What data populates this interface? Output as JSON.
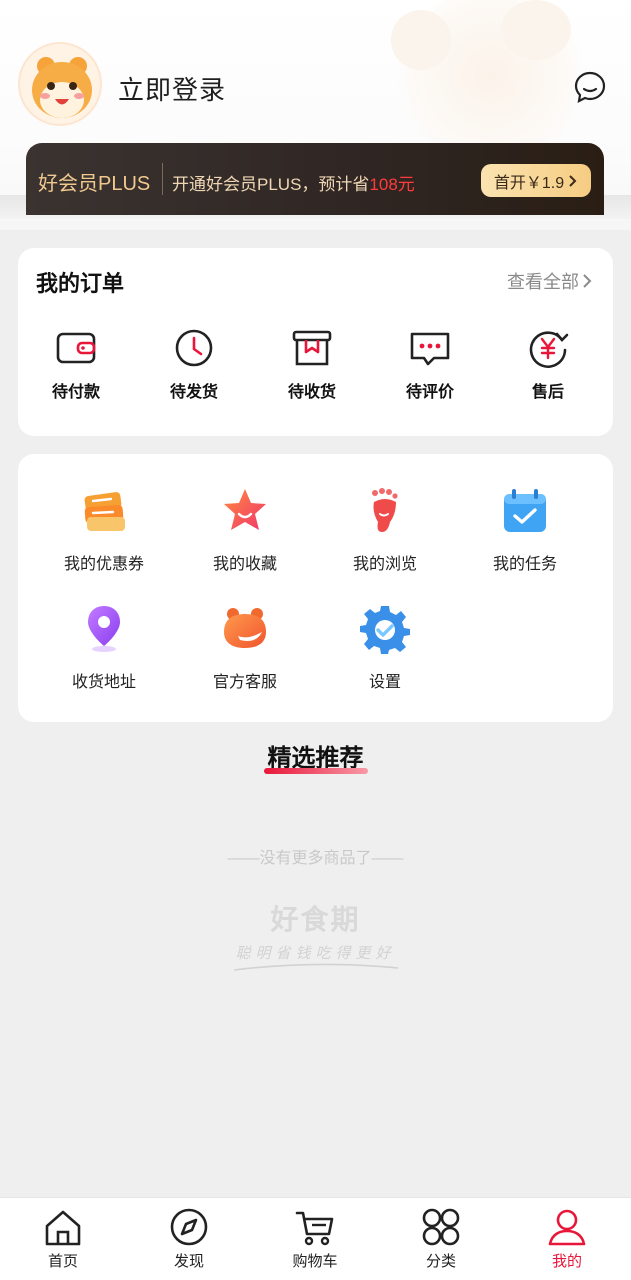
{
  "header": {
    "login_text": "立即登录",
    "message_icon": "chat-bubble-icon",
    "avatar_icon": "hamster-avatar-icon"
  },
  "plus": {
    "title": "好会员PLUS",
    "desc_prefix": "开通好会员PLUS，预计省",
    "save_amount": "108元",
    "button_label": "首开￥1.9",
    "accent_color": "#f1c98f",
    "highlight_color": "#ff3b3b"
  },
  "orders": {
    "title": "我的订单",
    "view_all": "查看全部",
    "items": [
      {
        "label": "待付款",
        "icon": "wallet-icon"
      },
      {
        "label": "待发货",
        "icon": "clock-icon"
      },
      {
        "label": "待收货",
        "icon": "box-icon"
      },
      {
        "label": "待评价",
        "icon": "comment-icon"
      },
      {
        "label": "售后",
        "icon": "yen-refresh-icon"
      }
    ]
  },
  "tools": {
    "items": [
      {
        "label": "我的优惠券",
        "icon": "coupon-icon"
      },
      {
        "label": "我的收藏",
        "icon": "star-icon"
      },
      {
        "label": "我的浏览",
        "icon": "footprint-icon"
      },
      {
        "label": "我的任务",
        "icon": "calendar-check-icon"
      },
      {
        "label": "收货地址",
        "icon": "location-pin-icon"
      },
      {
        "label": "官方客服",
        "icon": "customer-service-icon"
      },
      {
        "label": "设置",
        "icon": "settings-gear-icon"
      }
    ]
  },
  "recommend": {
    "title": "精选推荐",
    "no_more": "——没有更多商品了——",
    "brand": "好食期",
    "slogan": "聪明省钱吃得更好"
  },
  "tabbar": {
    "active_color": "#e8173a",
    "items": [
      {
        "label": "首页",
        "icon": "home-icon"
      },
      {
        "label": "发现",
        "icon": "compass-icon"
      },
      {
        "label": "购物车",
        "icon": "cart-icon"
      },
      {
        "label": "分类",
        "icon": "category-grid-icon"
      },
      {
        "label": "我的",
        "icon": "user-icon",
        "active": true
      }
    ]
  }
}
